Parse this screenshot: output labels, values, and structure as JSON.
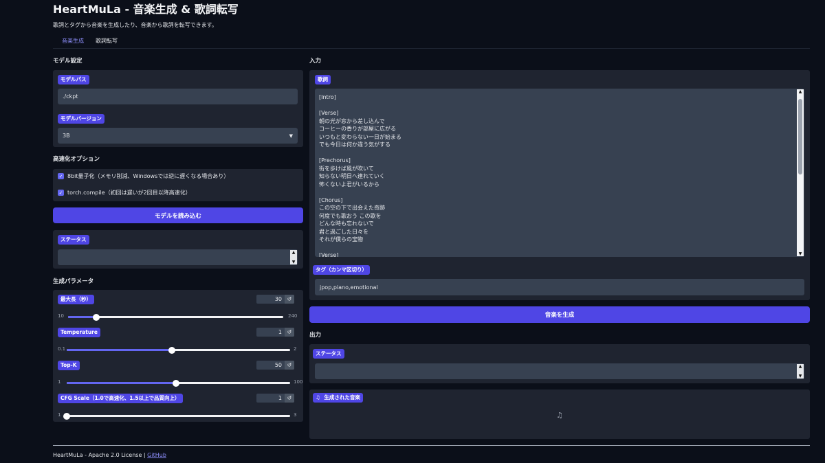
{
  "header": {
    "title": "HeartMuLa - 音楽生成 & 歌詞転写",
    "subtitle": "歌詞とタグから音楽を生成したり、音楽から歌詞を転写できます。"
  },
  "tabs": [
    {
      "label": "音楽生成",
      "active": true
    },
    {
      "label": "歌詞転写",
      "active": false
    }
  ],
  "model_settings": {
    "section_title": "モデル設定",
    "path_label": "モデルパス",
    "path_value": "./ckpt",
    "version_label": "モデルバージョン",
    "version_value": "3B"
  },
  "speed_options": {
    "section_title": "高速化オプション",
    "options": [
      {
        "label": "8bit量子化（メモリ削減、Windowsでは逆に遅くなる場合あり）",
        "checked": true
      },
      {
        "label": "torch.compile（初回は遅いが2回目以降高速化）",
        "checked": true
      }
    ],
    "load_button": "モデルを読み込む",
    "status_label": "ステータス",
    "status_value": ""
  },
  "gen_params": {
    "section_title": "生成パラメータ",
    "sliders": [
      {
        "label": "最大長（秒）",
        "value": "30",
        "min": "10",
        "max": "240",
        "fraction": 0.13
      },
      {
        "label": "Temperature",
        "value": "1",
        "min": "0.1",
        "max": "2",
        "fraction": 0.47
      },
      {
        "label": "Top-K",
        "value": "50",
        "min": "1",
        "max": "100",
        "fraction": 0.49
      },
      {
        "label": "CFG Scale（1.0で高速化、1.5以上で品質向上）",
        "value": "1",
        "min": "1",
        "max": "3",
        "fraction": 0.0
      }
    ]
  },
  "input": {
    "section_title": "入力",
    "lyrics_label": "歌詞",
    "lyrics": "[Intro]\n\n[Verse]\n朝の光が窓から差し込んで\nコーヒーの香りが部屋に広がる\nいつもと変わらない一日が始まる\nでも今日は何か違う気がする\n\n[Prechorus]\n街を歩けば風が吹いて\n知らない明日へ連れていく\n怖くないよ君がいるから\n\n[Chorus]\nこの空の下で出会えた奇跡\n何度でも歌おう この歌を\nどんな時も忘れないで\n君と過ごした日々を\nそれが僕らの宝物\n\n[Verse]",
    "tags_label": "タグ（カンマ区切り）",
    "tags_value": "jpop,piano,emotional",
    "generate_button": "音楽を生成"
  },
  "output": {
    "section_title": "出力",
    "status_label": "ステータス",
    "status_value": "",
    "audio_label": "生成された音楽"
  },
  "footer": {
    "text": "HeartMuLa - Apache 2.0 License | ",
    "link": "GitHub"
  },
  "colors": {
    "background": "#0b0f19",
    "panel": "#1f2430",
    "accent": "#4f46e5",
    "input": "#374151"
  }
}
